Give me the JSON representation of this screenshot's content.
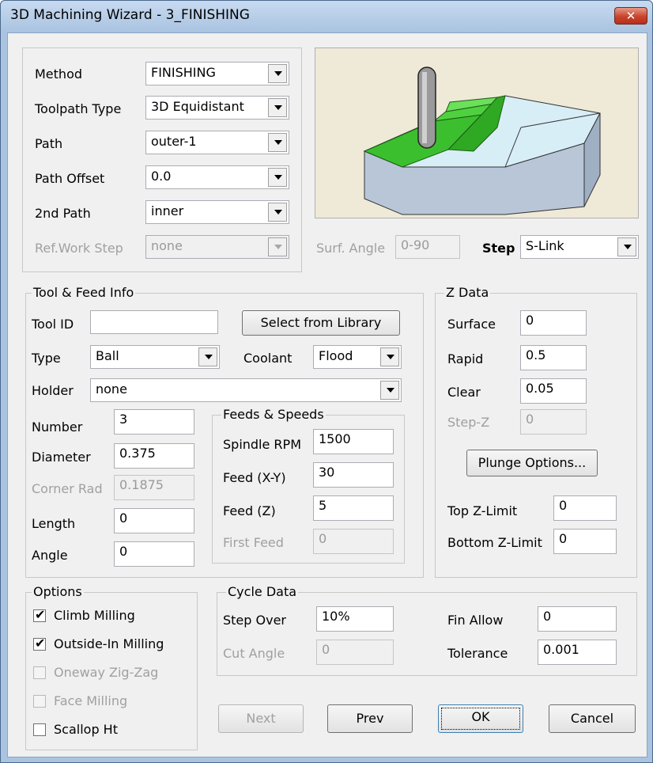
{
  "window": {
    "title": "3D Machining Wizard - 3_FINISHING",
    "close_label": "✕"
  },
  "method_panel": {
    "method": {
      "label": "Method",
      "value": "FINISHING"
    },
    "toolpath_type": {
      "label": "Toolpath Type",
      "value": "3D Equidistant"
    },
    "path": {
      "label": "Path",
      "value": "outer-1"
    },
    "path_offset": {
      "label": "Path Offset",
      "value": "0.0"
    },
    "second_path": {
      "label": "2nd Path",
      "value": "inner"
    },
    "ref_work_step": {
      "label": "Ref.Work Step",
      "value": "none"
    }
  },
  "preview_strip": {
    "surf_angle_label": "Surf. Angle",
    "surf_angle_value": "0-90",
    "step_label": "Step",
    "step_value": "S-Link"
  },
  "tool_feed": {
    "title": "Tool & Feed Info",
    "tool_id_label": "Tool ID",
    "tool_id_value": "",
    "select_library_label": "Select from Library",
    "type_label": "Type",
    "type_value": "Ball",
    "coolant_label": "Coolant",
    "coolant_value": "Flood",
    "holder_label": "Holder",
    "holder_value": "none",
    "number_label": "Number",
    "number_value": "3",
    "diameter_label": "Diameter",
    "diameter_value": "0.375",
    "corner_rad_label": "Corner Rad",
    "corner_rad_value": "0.1875",
    "length_label": "Length",
    "length_value": "0",
    "angle_label": "Angle",
    "angle_value": "0"
  },
  "feeds_speeds": {
    "title": "Feeds & Speeds",
    "spindle_label": "Spindle RPM",
    "spindle_value": "1500",
    "feed_xy_label": "Feed (X-Y)",
    "feed_xy_value": "30",
    "feed_z_label": "Feed (Z)",
    "feed_z_value": "5",
    "first_feed_label": "First Feed",
    "first_feed_value": "0"
  },
  "z_data": {
    "title": "Z Data",
    "surface_label": "Surface",
    "surface_value": "0",
    "rapid_label": "Rapid",
    "rapid_value": "0.5",
    "clear_label": "Clear",
    "clear_value": "0.05",
    "step_z_label": "Step-Z",
    "step_z_value": "0",
    "plunge_label": "Plunge Options...",
    "top_z_label": "Top Z-Limit",
    "top_z_value": "0",
    "bottom_z_label": "Bottom Z-Limit",
    "bottom_z_value": "0"
  },
  "options": {
    "title": "Options",
    "items": [
      {
        "label": "Climb Milling",
        "checked": true,
        "enabled": true
      },
      {
        "label": "Outside-In Milling",
        "checked": true,
        "enabled": true
      },
      {
        "label": "Oneway Zig-Zag",
        "checked": false,
        "enabled": false
      },
      {
        "label": "Face Milling",
        "checked": false,
        "enabled": false
      },
      {
        "label": "Scallop Ht",
        "checked": false,
        "enabled": true
      }
    ]
  },
  "cycle_data": {
    "title": "Cycle Data",
    "step_over_label": "Step Over",
    "step_over_value": "10%",
    "cut_angle_label": "Cut Angle",
    "cut_angle_value": "0",
    "fin_allow_label": "Fin Allow",
    "fin_allow_value": "0",
    "tolerance_label": "Tolerance",
    "tolerance_value": "0.001"
  },
  "buttons": {
    "next": "Next",
    "prev": "Prev",
    "ok": "OK",
    "cancel": "Cancel"
  }
}
